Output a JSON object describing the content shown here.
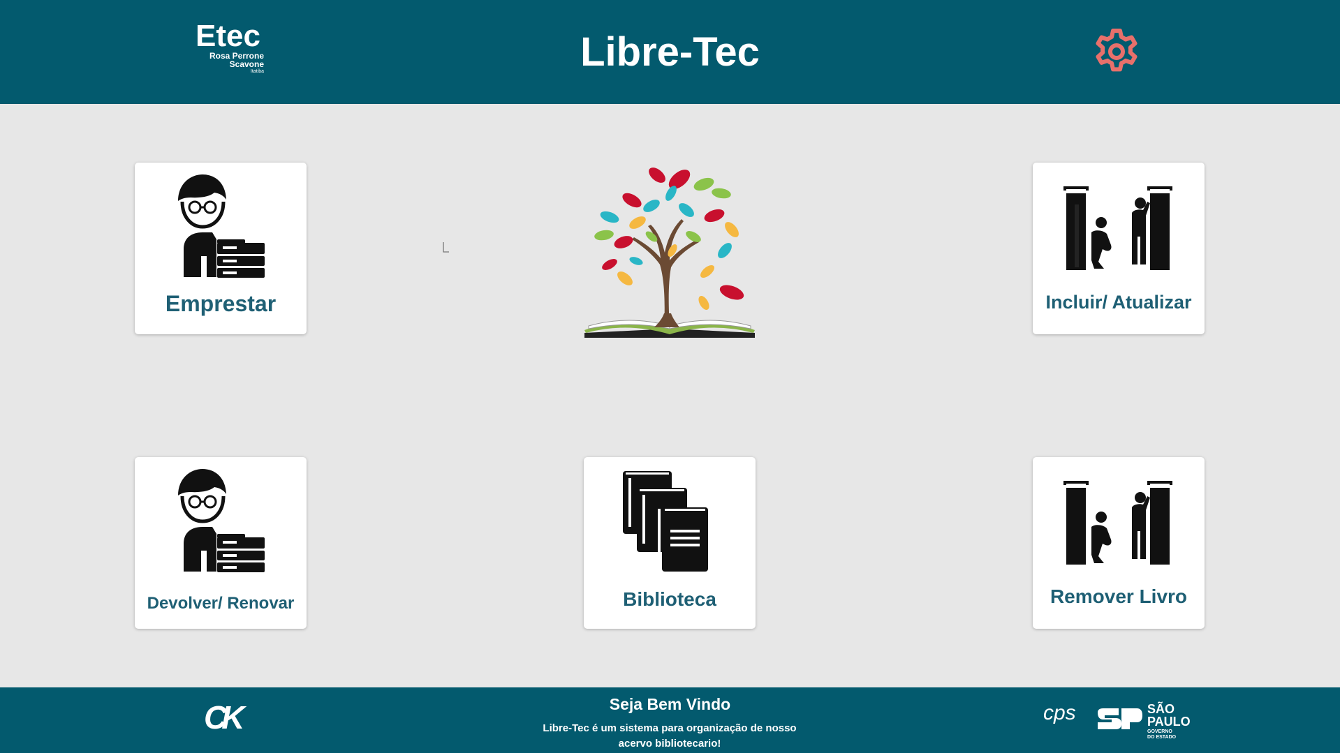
{
  "header": {
    "logo": {
      "name": "Etec",
      "line1": "Rosa Perrone",
      "line2": "Scavone",
      "line3": "Itatiba"
    },
    "title": "Libre-Tec",
    "settings_icon": "gear-icon"
  },
  "cards": [
    {
      "label": "Emprestar",
      "icon": "librarian-lending-icon"
    },
    {
      "label": "Incluir/ Atualizar",
      "icon": "bookshelf-workers-icon"
    },
    {
      "label": "Devolver/ Renovar",
      "icon": "librarian-returning-icon"
    },
    {
      "label": "Biblioteca",
      "icon": "books-stack-icon"
    },
    {
      "label": "Remover Livro",
      "icon": "bookshelf-workers-icon"
    }
  ],
  "center_image": "tree-on-open-book",
  "footer": {
    "heading": "Seja Bem Vindo",
    "text": "Libre-Tec é um sistema para organização de nosso acervo bibliotecario!",
    "left_logo": {
      "mark": "CK"
    },
    "right_logos": {
      "cps": "cps",
      "state_line1": "SÃO",
      "state_line2": "PAULO",
      "gov_line1": "GOVERNO",
      "gov_line2": "DO ESTADO"
    }
  },
  "colors": {
    "header_bg": "#035a6e",
    "page_bg": "#e7e7e7",
    "label": "#1e5f74",
    "gear": "#e8706b"
  }
}
